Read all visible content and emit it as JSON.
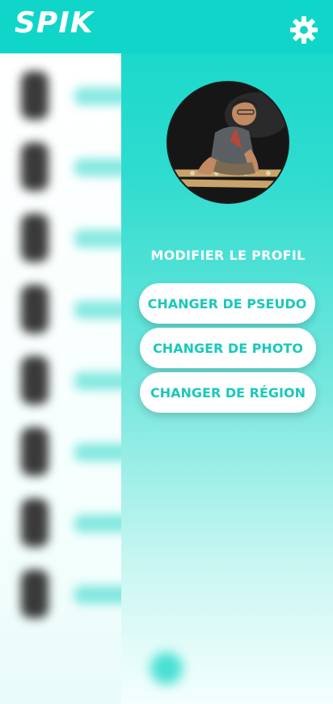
{
  "app": {
    "title": "SPIK",
    "accent_color": "#0fd6c8",
    "settings_icon": "gear-icon"
  },
  "profile": {
    "photo_icon": "profile-photo",
    "heading": "MODIFIER LE PROFIL",
    "buttons": [
      {
        "label": "CHANGER DE PSEUDO"
      },
      {
        "label": "CHANGER DE PHOTO"
      },
      {
        "label": "CHANGER DE RÉGION"
      }
    ]
  },
  "background_list": {
    "item_count": 8,
    "blurred": true
  }
}
